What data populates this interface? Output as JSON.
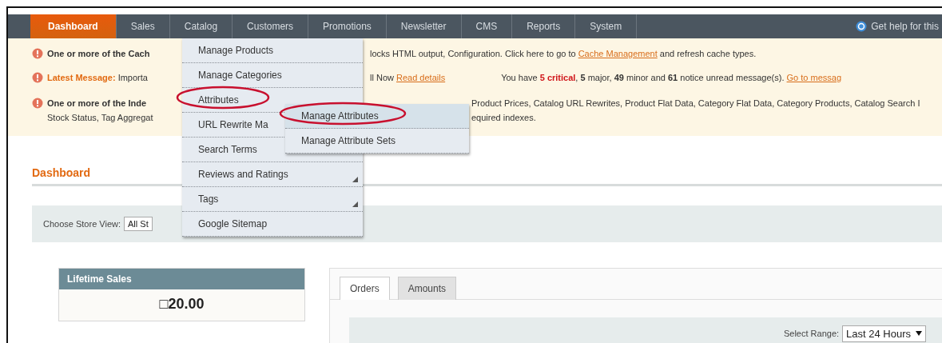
{
  "nav": {
    "tabs": [
      {
        "label": "Dashboard",
        "selected": true
      },
      {
        "label": "Sales",
        "selected": false
      },
      {
        "label": "Catalog",
        "selected": false
      },
      {
        "label": "Customers",
        "selected": false
      },
      {
        "label": "Promotions",
        "selected": false
      },
      {
        "label": "Newsletter",
        "selected": false
      },
      {
        "label": "CMS",
        "selected": false
      },
      {
        "label": "Reports",
        "selected": false
      },
      {
        "label": "System",
        "selected": false
      }
    ],
    "help": "Get help for this"
  },
  "messages": [
    {
      "kind": "cache",
      "lead": "One or more of the Cach",
      "text": "locks HTML output, Configuration. Click here to go to ",
      "link": "Cache Management",
      "tail": " and refresh cache types."
    },
    {
      "kind": "latest",
      "label": "Latest Message:",
      "lead": " Importa",
      "text": "ll Now ",
      "link": "Read details",
      "notice": "You have **5 critical**, **5** major, **49** minor and **61** notice unread message(s). ",
      "notice_link": "Go to messag"
    },
    {
      "kind": "index",
      "lead": "One or more of the Inde",
      "text": "Product Prices, Catalog URL Rewrites, Product Flat Data, Category Flat Data, Category Products, Catalog Search I",
      "lead2": "Stock Status, Tag Aggregat",
      "text2": "equired indexes."
    }
  ],
  "menu": {
    "items": [
      {
        "label": "Manage Products",
        "has_submenu": false,
        "circled": false
      },
      {
        "label": "Manage Categories",
        "has_submenu": false,
        "circled": false
      },
      {
        "label": "Attributes",
        "has_submenu": false,
        "circled": true,
        "expanded": true,
        "children": [
          {
            "label": "Manage Attributes",
            "selected": true,
            "circled": true
          },
          {
            "label": "Manage Attribute Sets",
            "selected": false,
            "circled": false
          }
        ]
      },
      {
        "label": "URL Rewrite Ma",
        "has_submenu": false,
        "circled": false
      },
      {
        "label": "Search Terms",
        "has_submenu": false,
        "circled": false
      },
      {
        "label": "Reviews and Ratings",
        "has_submenu": true,
        "circled": false
      },
      {
        "label": "Tags",
        "has_submenu": true,
        "circled": false
      },
      {
        "label": "Google Sitemap",
        "has_submenu": false,
        "circled": false
      }
    ]
  },
  "page_title": "Dashboard",
  "store_view": {
    "label": "Choose Store View:",
    "value": "All St"
  },
  "lifetime_sales": {
    "title": "Lifetime Sales",
    "value": "□20.00"
  },
  "chart_tabs": [
    {
      "label": "Orders",
      "selected": true
    },
    {
      "label": "Amounts",
      "selected": false
    }
  ],
  "range": {
    "label": "Select Range:",
    "value": "Last 24 Hours"
  }
}
